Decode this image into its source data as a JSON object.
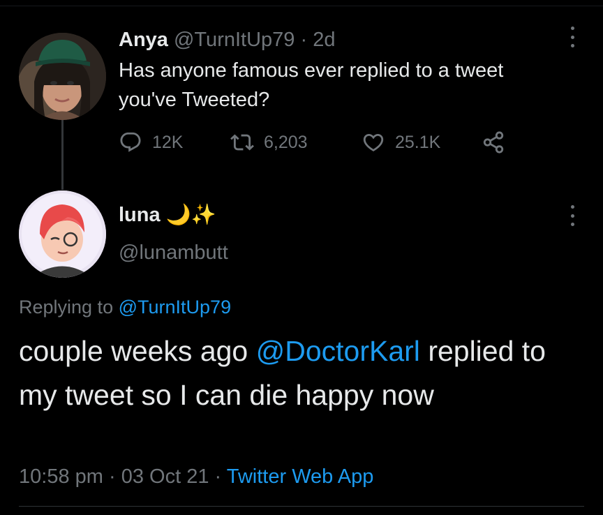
{
  "parent_tweet": {
    "display_name": "Anya",
    "handle": "@TurnItUp79",
    "separator": "·",
    "age": "2d",
    "text": "Has anyone famous ever replied to a tweet you've Tweeted?",
    "actions": {
      "replies": "12K",
      "retweets": "6,203",
      "likes": "25.1K"
    },
    "icons": {
      "reply": "reply-icon",
      "retweet": "retweet-icon",
      "like": "heart-icon",
      "share": "share-icon",
      "more": "more-icon"
    }
  },
  "main_tweet": {
    "display_name": "luna",
    "name_emoji": "🌙✨",
    "handle": "@lunambutt",
    "replying_prefix": "Replying to",
    "replying_to": "@TurnItUp79",
    "text_part1": "couple weeks ago ",
    "mention": "@DoctorKarl",
    "text_part2": " replied to my tweet so I can die happy now",
    "time": "10:58 pm",
    "date": "03 Oct 21",
    "source": "Twitter Web App",
    "separator": "·"
  },
  "colors": {
    "background": "#000000",
    "text": "#e7e9ea",
    "muted": "#71767b",
    "link": "#1d9bf0",
    "divider": "#2f3336"
  }
}
